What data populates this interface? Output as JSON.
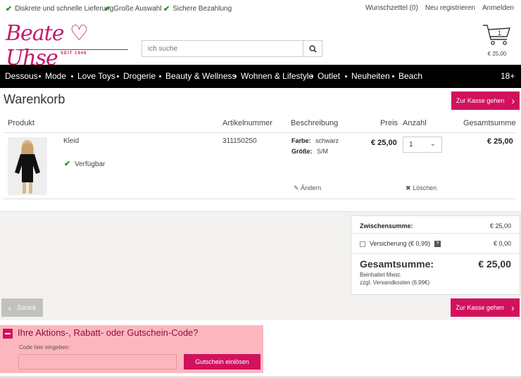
{
  "topbar": {
    "usps": [
      "Diskrete und schnelle Lieferung",
      "Große Auswahl",
      "Sichere Bezahlung"
    ],
    "links": [
      "Wunschzettel (0)",
      "Neu registrieren",
      "Anmelden"
    ]
  },
  "header": {
    "logo_text": "Beate ♡ Uhse",
    "logo_sub": "SEIT 1946",
    "search_placeholder": "ich suche",
    "cart_count": "1",
    "cart_total": "€ 25,00"
  },
  "nav": {
    "items": [
      "Dessous",
      "Mode",
      "Love Toys",
      "Drogerie",
      "Beauty & Wellness",
      "Wohnen & Lifestyle",
      "Outlet",
      "Neuheiten",
      "Beach"
    ],
    "age_badge": "18+"
  },
  "cart": {
    "title": "Warenkorb",
    "checkout_label": "Zur Kasse gehen",
    "columns": {
      "product": "Produkt",
      "article_number": "Artikelnummer",
      "description": "Beschreibung",
      "price": "Preis",
      "quantity": "Anzahl",
      "total": "Gesamtsumme"
    },
    "item": {
      "name": "Kleid",
      "availability": "Verfügbar",
      "article_number": "311150250",
      "color_label": "Farbe:",
      "color_value": "schwarz",
      "size_label": "Größe:",
      "size_value": "S/M",
      "price": "€ 25,00",
      "quantity": "1",
      "total": "€ 25,00",
      "edit_label": "Ändern",
      "delete_label": "Löschen"
    }
  },
  "summary": {
    "subtotal_label": "Zwischensumme:",
    "subtotal_value": "€ 25,00",
    "insurance_label": "Versicherung (€ 0,99)",
    "insurance_value": "€ 0,00",
    "grand_total_label": "Gesamtsumme:",
    "grand_total_value": "€ 25,00",
    "vat_note": "Beinhaltet Mwst.",
    "shipping_note": "zzgl. Versandkosten (6,99€)"
  },
  "actions": {
    "back_label": "Zurück",
    "checkout_label": "Zur Kasse gehen"
  },
  "coupon": {
    "title": "Ihre Aktions-, Rabatt- oder Gutschein-Code?",
    "input_label": "Code hier eingeben:",
    "input_value": "",
    "submit_label": "Gutschein einlösen"
  },
  "colors": {
    "brand": "#d1115e",
    "nav_bg": "#000000",
    "check": "#2a8a2a",
    "highlight": "#fcb7be"
  }
}
